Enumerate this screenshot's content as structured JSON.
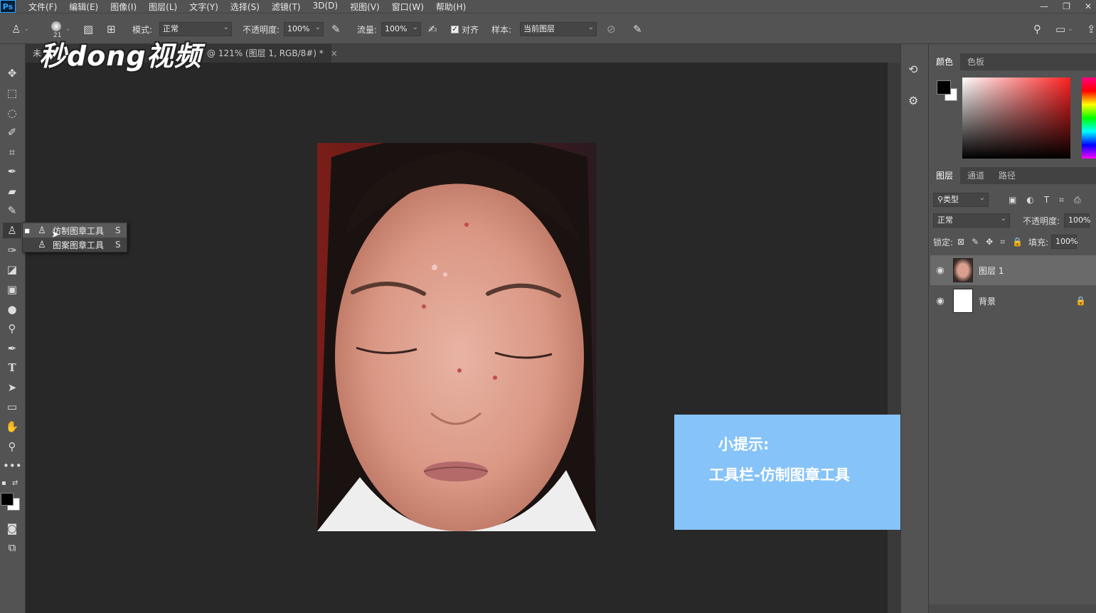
{
  "app": {
    "logo": "Ps"
  },
  "menu": [
    "文件(F)",
    "编辑(E)",
    "图像(I)",
    "图层(L)",
    "文字(Y)",
    "选择(S)",
    "滤镜(T)",
    "3D(D)",
    "视图(V)",
    "窗口(W)",
    "帮助(H)"
  ],
  "options": {
    "brush_size": "21",
    "mode_label": "模式:",
    "mode_value": "正常",
    "opacity_label": "不透明度:",
    "opacity_value": "100%",
    "flow_label": "流量:",
    "flow_value": "100%",
    "aligned_label": "对齐",
    "sample_label": "样本:",
    "sample_value": "当前图层"
  },
  "tab": {
    "prefix": "未",
    "title": "@ 121% (图层 1, RGB/8#) *",
    "close": "×"
  },
  "watermark": "秒dong视频",
  "flyout": [
    {
      "label": "仿制图章工具",
      "key": "S"
    },
    {
      "label": "图案图章工具",
      "key": "S"
    }
  ],
  "tip": {
    "title": "小提示:",
    "body": "工具栏-仿制图章工具"
  },
  "color_panel": {
    "tabs": [
      "颜色",
      "色板"
    ]
  },
  "layers_panel": {
    "tabs": [
      "图层",
      "通道",
      "路径"
    ],
    "filter_label": "类型",
    "blend_mode": "正常",
    "opacity_label": "不透明度:",
    "opacity_value": "100%",
    "lock_label": "锁定:",
    "fill_label": "填充:",
    "fill_value": "100%",
    "layers": [
      {
        "name": "图层 1",
        "selected": true
      },
      {
        "name": "背景",
        "locked": true
      }
    ]
  }
}
